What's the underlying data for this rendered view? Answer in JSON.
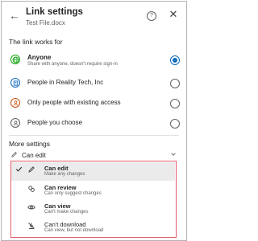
{
  "header": {
    "back_icon": "←",
    "title": "Link settings",
    "file_name": "Test File.docx",
    "help_icon": "?",
    "close_icon": "✕"
  },
  "link_works_for": {
    "label": "The link works for",
    "options": [
      {
        "title": "Anyone",
        "description": "Share with anyone, doesn't require sign-in",
        "selected": true,
        "icon": "globe-icon",
        "icon_color": "#13a10e"
      },
      {
        "title": "People in Reality Tech, Inc",
        "description": "",
        "selected": false,
        "icon": "building-icon",
        "icon_color": "#0f6cbd"
      },
      {
        "title": "Only people with existing access",
        "description": "",
        "selected": false,
        "icon": "people-icon",
        "icon_color": "#ca5010"
      },
      {
        "title": "People you choose",
        "description": "",
        "selected": false,
        "icon": "person-icon",
        "icon_color": "#616161"
      }
    ]
  },
  "more_settings": {
    "label": "More settings",
    "dropdown_value": "Can edit",
    "menu_items": [
      {
        "title": "Can edit",
        "description": "Make any changes",
        "selected": true,
        "icon": "pencil-icon"
      },
      {
        "title": "Can review",
        "description": "Can only suggest changes",
        "selected": false,
        "icon": "review-icon"
      },
      {
        "title": "Can view",
        "description": "Can't make changes",
        "selected": false,
        "icon": "eye-icon"
      },
      {
        "title": "Can't download",
        "description": "Can view, but not download",
        "selected": false,
        "icon": "no-download-icon"
      }
    ]
  },
  "colors": {
    "accent": "#0f6cbd",
    "highlight_border": "#e35b6b",
    "selected_row": "#ebebeb"
  }
}
